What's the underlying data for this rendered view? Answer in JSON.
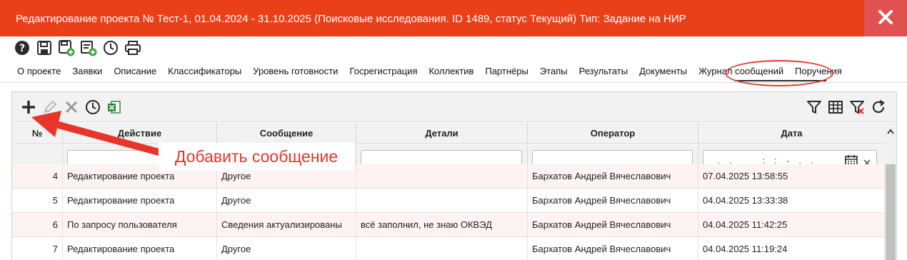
{
  "window": {
    "title": "Редактирование проекта № Тест-1, 01.04.2024 - 31.10.2025 (Поисковые исследования. ID 1489, статус Текущий) Тип: Задание на НИР",
    "accent": "#ea4019"
  },
  "toolbar": {
    "icons": [
      "help-icon",
      "save-icon",
      "save-add-icon",
      "save-approve-icon",
      "history-icon",
      "print-icon"
    ]
  },
  "tabs": [
    "О проекте",
    "Заявки",
    "Описание",
    "Классификаторы",
    "Уровень готовности",
    "Госрегистрация",
    "Коллектив",
    "Партнёры",
    "Этапы",
    "Результаты",
    "Документы",
    "Журнал сообщений",
    "Поручения"
  ],
  "active_tab": "Журнал сообщений",
  "grid": {
    "columns": [
      "№",
      "Действие",
      "Сообщение",
      "Детали",
      "Оператор",
      "Дата"
    ],
    "date_filter_mask": "__.__.____ __:__:__-__.__.____ __:_",
    "rows": [
      {
        "n": "4",
        "action": "Редактирование проекта",
        "message": "Другое",
        "details": "",
        "operator": "Бархатов Андрей Вячеславович",
        "date": "07.04.2025 13:58:55"
      },
      {
        "n": "5",
        "action": "Редактирование проекта",
        "message": "Другое",
        "details": "",
        "operator": "Бархатов Андрей Вячеславович",
        "date": "04.04.2025 13:33:38"
      },
      {
        "n": "6",
        "action": "По запросу пользователя",
        "message": "Сведения актуализированы",
        "details": "всё заполнил, не знаю ОКВЭД",
        "operator": "Бархатов Андрей Вячеславович",
        "date": "04.04.2025 11:42:25"
      },
      {
        "n": "7",
        "action": "Редактирование проекта",
        "message": "Другое",
        "details": "",
        "operator": "Бархатов Андрей Вячеславович",
        "date": "04.04.2025 11:19:24"
      }
    ]
  },
  "annotation": {
    "callout": "Добавить сообщение",
    "color": "#e8352a"
  }
}
